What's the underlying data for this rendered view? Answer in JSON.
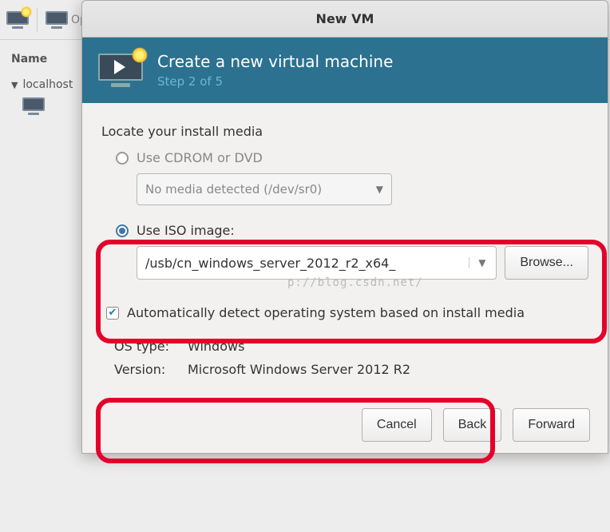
{
  "bg": {
    "toolbar": {
      "open": "Open"
    },
    "name_header": "Name",
    "tree": {
      "root": "localhost"
    }
  },
  "dialog": {
    "title": "New VM",
    "banner": {
      "heading": "Create a new virtual machine",
      "step": "Step 2 of 5"
    },
    "locate_label": "Locate your install media",
    "cdrom": {
      "label": "Use CDROM or DVD",
      "value": "No media detected (/dev/sr0)"
    },
    "iso": {
      "label": "Use ISO image:",
      "value": "/usb/cn_windows_server_2012_r2_x64_",
      "browse": "Browse..."
    },
    "autodetect": "Automatically detect operating system based on install media",
    "os": {
      "type_label": "OS type:",
      "type_value": "Windows",
      "version_label": "Version:",
      "version_value": "Microsoft Windows Server 2012 R2"
    },
    "buttons": {
      "cancel": "Cancel",
      "back": "Back",
      "forward": "Forward"
    }
  },
  "watermark": "p://blog.csdn.net/"
}
